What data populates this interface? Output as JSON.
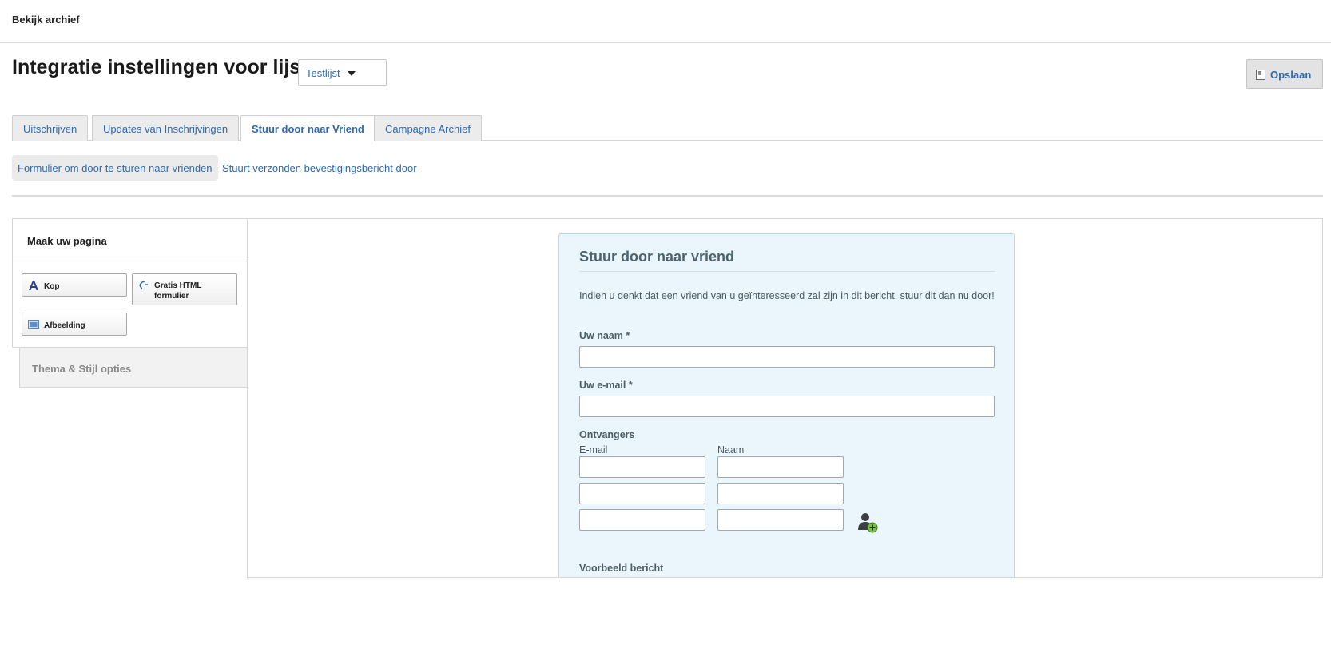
{
  "header": {
    "archive_link": "Bekijk archief"
  },
  "page": {
    "title": "Integratie instellingen voor lijst",
    "list_select": "Testlijst",
    "save_label": "Opslaan"
  },
  "tabs": [
    {
      "label": "Uitschrijven",
      "active": false
    },
    {
      "label": "Updates van Inschrijvingen",
      "active": false
    },
    {
      "label": "Stuur door naar Vriend",
      "active": true
    },
    {
      "label": "Campagne Archief",
      "active": false
    }
  ],
  "subnav": [
    {
      "label": "Formulier om door te sturen naar vrienden",
      "active": true
    },
    {
      "label": "Stuurt verzonden bevestigingsbericht door",
      "active": false
    }
  ],
  "builder": {
    "panel_title": "Maak uw pagina",
    "blocks": [
      {
        "label": "Kop",
        "icon": "heading-icon"
      },
      {
        "label": "Gratis HTML formulier",
        "icon": "html-form-icon"
      },
      {
        "label": "Afbeelding",
        "icon": "image-icon"
      }
    ],
    "theme_label": "Thema & Stijl opties"
  },
  "form": {
    "title": "Stuur door naar vriend",
    "intro": "Indien u denkt dat een vriend van u geïnteresseerd zal zijn in dit bericht, stuur dit dan nu door!",
    "name_label": "Uw naam *",
    "email_label": "Uw e-mail *",
    "recipients_label": "Ontvangers",
    "col_email": "E-mail",
    "col_name": "Naam",
    "preview_label": "Voorbeeld bericht"
  },
  "colors": {
    "link": "#2d6ab3",
    "form_background": "#eaf6fb",
    "form_border": "#bcd7e6"
  }
}
